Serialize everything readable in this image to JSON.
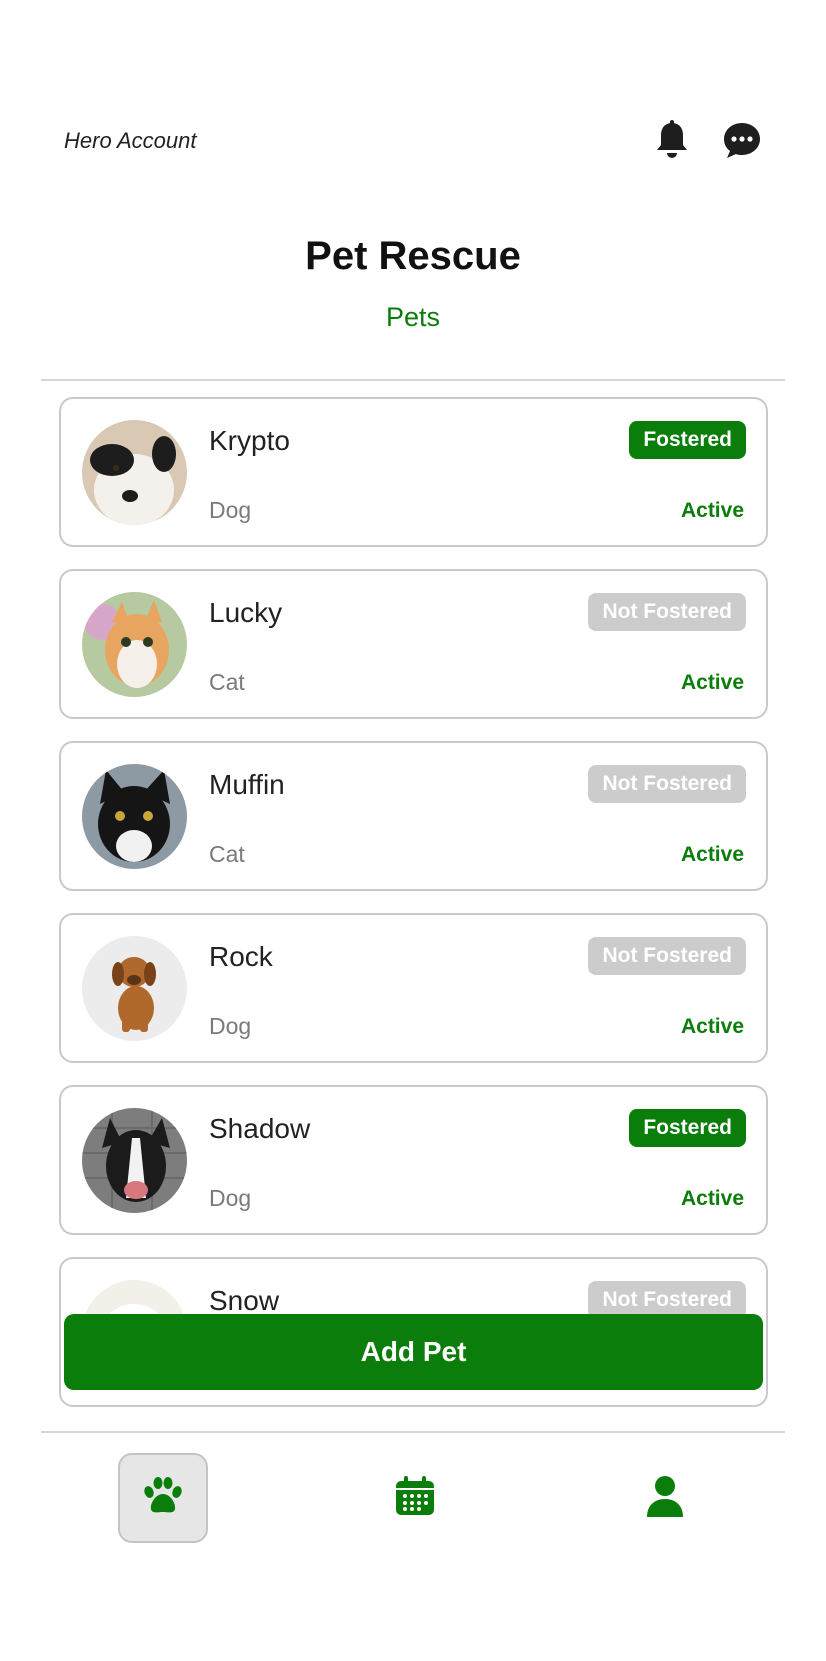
{
  "header": {
    "account_label": "Hero Account",
    "title": "Pet Rescue",
    "subtitle": "Pets",
    "icons": [
      "bell-icon",
      "chat-bubble-icon"
    ]
  },
  "pets": [
    {
      "name": "Krypto",
      "type": "Dog",
      "foster": "Fostered",
      "fostered": true,
      "status": "Active",
      "photo": "dog-black-white"
    },
    {
      "name": "Lucky",
      "type": "Cat",
      "foster": "Not Fostered",
      "fostered": false,
      "status": "Active",
      "photo": "cat-orange-white"
    },
    {
      "name": "Muffin",
      "type": "Cat",
      "foster": "Not Fostered",
      "fostered": false,
      "status": "Active",
      "photo": "cat-black-white"
    },
    {
      "name": "Rock",
      "type": "Dog",
      "foster": "Not Fostered",
      "fostered": false,
      "status": "Active",
      "photo": "puppy-brown"
    },
    {
      "name": "Shadow",
      "type": "Dog",
      "foster": "Fostered",
      "fostered": true,
      "status": "Active",
      "photo": "dog-border-collie"
    },
    {
      "name": "Snow",
      "type": "",
      "foster": "Not Fostered",
      "fostered": false,
      "status": "",
      "photo": "white-pet"
    }
  ],
  "actions": {
    "add_pet_label": "Add Pet"
  },
  "tabbar": {
    "items": [
      {
        "icon": "paw-icon",
        "selected": true
      },
      {
        "icon": "calendar-icon",
        "selected": false
      },
      {
        "icon": "user-icon",
        "selected": false
      }
    ]
  },
  "colors": {
    "accent": "#0b7d0b",
    "badge_inactive": "#cccccc",
    "border": "#c9c9c9"
  }
}
